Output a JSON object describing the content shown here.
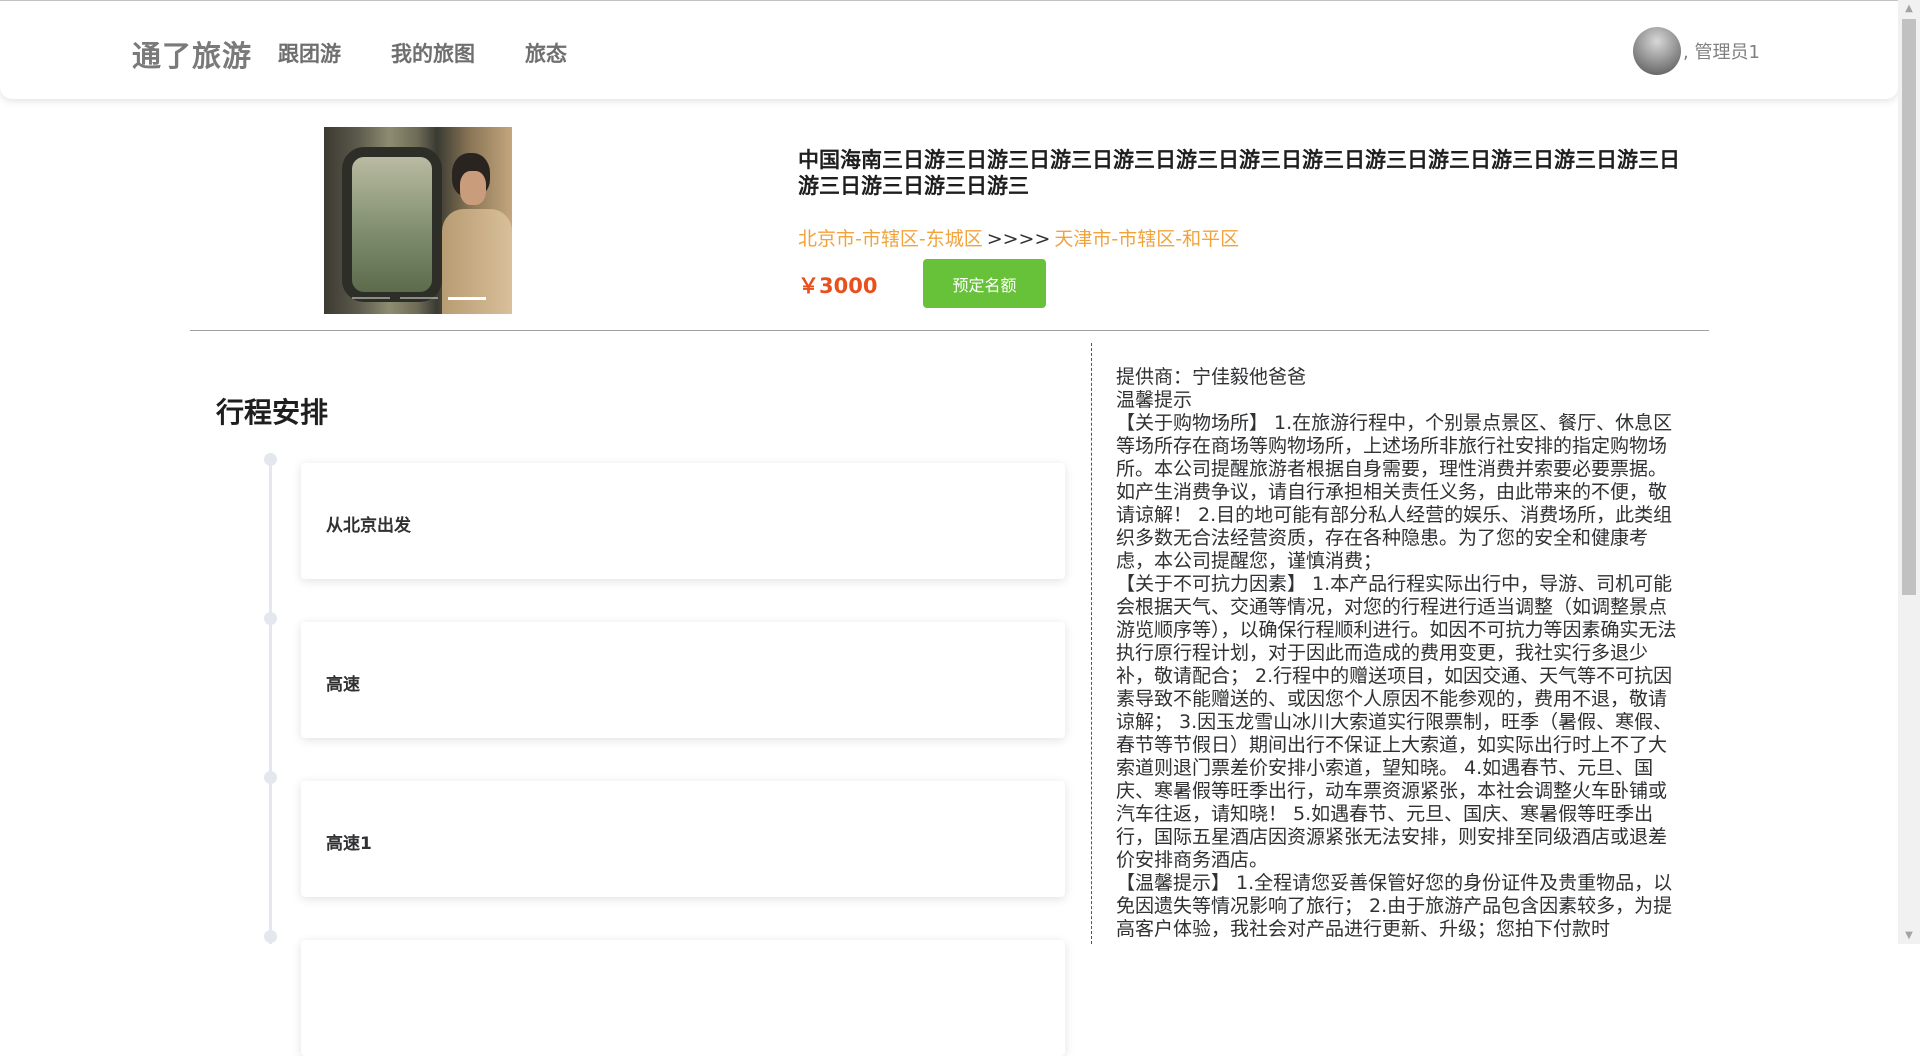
{
  "header": {
    "brand": "通了旅游",
    "nav": [
      "跟团游",
      "我的旅图",
      "旅态"
    ],
    "username": ", 管理员1"
  },
  "product": {
    "title": "中国海南三日游三日游三日游三日游三日游三日游三日游三日游三日游三日游三日游三日游三日游三日游三日游三日游三",
    "route_from": "北京市-市辖区-东城区",
    "route_arrow": ">>>>",
    "route_to": "天津市-市辖区-和平区",
    "price": "￥3000",
    "book_label": "预定名额",
    "carousel_slides": 3,
    "carousel_active": 3
  },
  "itinerary": {
    "title": "行程安排",
    "items": [
      "从北京出发",
      "高速",
      "高速1"
    ]
  },
  "notes": {
    "provider": "提供商：宁佳毅他爸爸",
    "heading": "温馨提示",
    "paragraphs": [
      "【关于购物场所】 1.在旅游行程中，个别景点景区、餐厅、休息区等场所存在商场等购物场所，上述场所非旅行社安排的指定购物场所。本公司提醒旅游者根据自身需要，理性消费并索要必要票据。如产生消费争议，请自行承担相关责任义务，由此带来的不便，敬请谅解！ 2.目的地可能有部分私人经营的娱乐、消费场所，此类组织多数无合法经营资质，存在各种隐患。为了您的安全和健康考虑，本公司提醒您，谨慎消费；",
      "【关于不可抗力因素】 1.本产品行程实际出行中，导游、司机可能会根据天气、交通等情况，对您的行程进行适当调整（如调整景点游览顺序等），以确保行程顺利进行。如因不可抗力等因素确实无法执行原行程计划，对于因此而造成的费用变更，我社实行多退少补，敬请配合； 2.行程中的赠送项目，如因交通、天气等不可抗因素导致不能赠送的、或因您个人原因不能参观的，费用不退，敬请谅解； 3.因玉龙雪山冰川大索道实行限票制，旺季（暑假、寒假、春节等节假日）期间出行不保证上大索道，如实际出行时上不了大索道则退门票差价安排小索道，望知晓。 4.如遇春节、元旦、国庆、寒暑假等旺季出行，动车票资源紧张，本社会调整火车卧铺或汽车往返，请知晓！ 5.如遇春节、元旦、国庆、寒暑假等旺季出行，国际五星酒店因资源紧张无法安排，则安排至同级酒店或退差价安排商务酒店。",
      "【温馨提示】 1.全程请您妥善保管好您的身份证件及贵重物品，以免因遗失等情况影响了旅行； 2.由于旅游产品包含因素较多，为提高客户体验，我社会对产品进行更新、升级；您拍下付款时"
    ]
  },
  "colors": {
    "brand": "#7a7a7a",
    "route": "#f2a33a",
    "price": "#e8501e",
    "book_button": "#67c23a"
  },
  "icons": {
    "avatar": "avatar-image",
    "scroll_up": "scroll-up-arrow-icon",
    "scroll_down": "scroll-down-arrow-icon"
  }
}
